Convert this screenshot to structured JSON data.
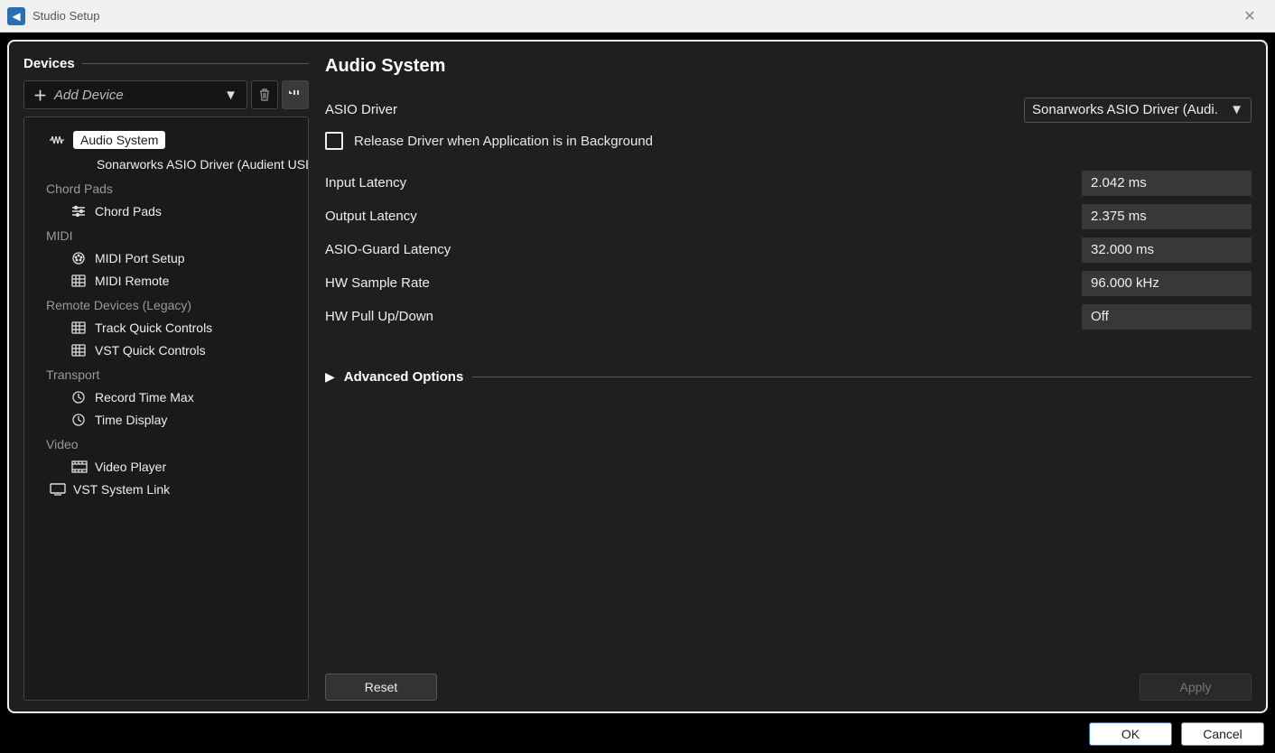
{
  "window": {
    "title": "Studio Setup"
  },
  "sidebar": {
    "header": "Devices",
    "add_label": "Add Device",
    "items": {
      "audio_system": "Audio System",
      "sonarworks": "Sonarworks ASIO Driver (Audient USB",
      "chord_pads_group": "Chord Pads",
      "chord_pads": "Chord Pads",
      "midi_group": "MIDI",
      "midi_port_setup": "MIDI Port Setup",
      "midi_remote": "MIDI Remote",
      "remote_group": "Remote Devices (Legacy)",
      "track_quick": "Track Quick Controls",
      "vst_quick": "VST Quick Controls",
      "transport_group": "Transport",
      "record_time": "Record Time Max",
      "time_display": "Time Display",
      "video_group": "Video",
      "video_player": "Video Player",
      "vst_link": "VST System Link"
    }
  },
  "main": {
    "title": "Audio System",
    "asio_label": "ASIO Driver",
    "asio_value": "Sonarworks ASIO Driver (Audi.",
    "release_label": "Release Driver when Application is in Background",
    "release_checked": false,
    "rows": {
      "input_latency": {
        "label": "Input Latency",
        "value": "2.042 ms"
      },
      "output_latency": {
        "label": "Output Latency",
        "value": "2.375 ms"
      },
      "asio_guard": {
        "label": "ASIO-Guard Latency",
        "value": "32.000 ms"
      },
      "sample_rate": {
        "label": "HW Sample Rate",
        "value": "96.000 kHz"
      },
      "pull": {
        "label": "HW Pull Up/Down",
        "value": "Off"
      }
    },
    "advanced_label": "Advanced Options",
    "reset": "Reset",
    "apply": "Apply"
  },
  "footer": {
    "ok": "OK",
    "cancel": "Cancel"
  }
}
